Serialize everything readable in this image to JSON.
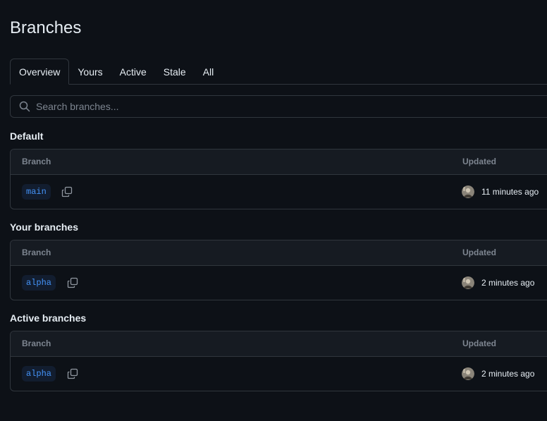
{
  "page": {
    "title": "Branches"
  },
  "tabs": [
    {
      "label": "Overview",
      "selected": true
    },
    {
      "label": "Yours",
      "selected": false
    },
    {
      "label": "Active",
      "selected": false
    },
    {
      "label": "Stale",
      "selected": false
    },
    {
      "label": "All",
      "selected": false
    }
  ],
  "search": {
    "placeholder": "Search branches...",
    "value": "",
    "icon": "search-icon"
  },
  "sections": [
    {
      "title": "Default",
      "headers": {
        "branch": "Branch",
        "updated": "Updated"
      },
      "rows": [
        {
          "branch": "main",
          "updated": "11 minutes ago"
        }
      ]
    },
    {
      "title": "Your branches",
      "headers": {
        "branch": "Branch",
        "updated": "Updated"
      },
      "rows": [
        {
          "branch": "alpha",
          "updated": "2 minutes ago"
        }
      ]
    },
    {
      "title": "Active branches",
      "headers": {
        "branch": "Branch",
        "updated": "Updated"
      },
      "rows": [
        {
          "branch": "alpha",
          "updated": "2 minutes ago"
        }
      ]
    }
  ],
  "colors": {
    "background": "#0d1117",
    "border": "#30363d",
    "header_bg": "#161b22",
    "branch_text": "#4493f8",
    "branch_bg": "#121d2f",
    "muted": "#7d8590"
  }
}
